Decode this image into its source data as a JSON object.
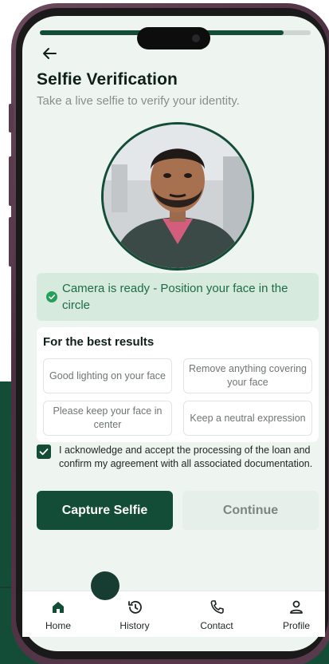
{
  "screen": {
    "title": "Selfie Verification",
    "subtitle": "Take a live selfie to verify your identity.",
    "progress_fraction": 0.9
  },
  "camera_status": {
    "message": "Camera is ready - Position your face in the circle"
  },
  "tips": {
    "title": "For the best results",
    "items": [
      "Good lighting on your face",
      "Remove anything covering your face",
      "Please keep your face in center",
      "Keep a neutral expression"
    ]
  },
  "acknowledgement": {
    "checked": true,
    "text": "I acknowledge and accept the processing of the loan and confirm my agreement with all associated documentation."
  },
  "actions": {
    "capture_label": "Capture Selfie",
    "continue_label": "Continue"
  },
  "nav": {
    "items": [
      {
        "label": "Home",
        "icon": "home-icon"
      },
      {
        "label": "History",
        "icon": "history-icon"
      },
      {
        "label": "Contact",
        "icon": "phone-icon"
      },
      {
        "label": "Profile",
        "icon": "profile-icon"
      }
    ]
  },
  "colors": {
    "brand_green": "#134d37",
    "success_green": "#25a05a",
    "banner_bg": "#d6ebde"
  }
}
